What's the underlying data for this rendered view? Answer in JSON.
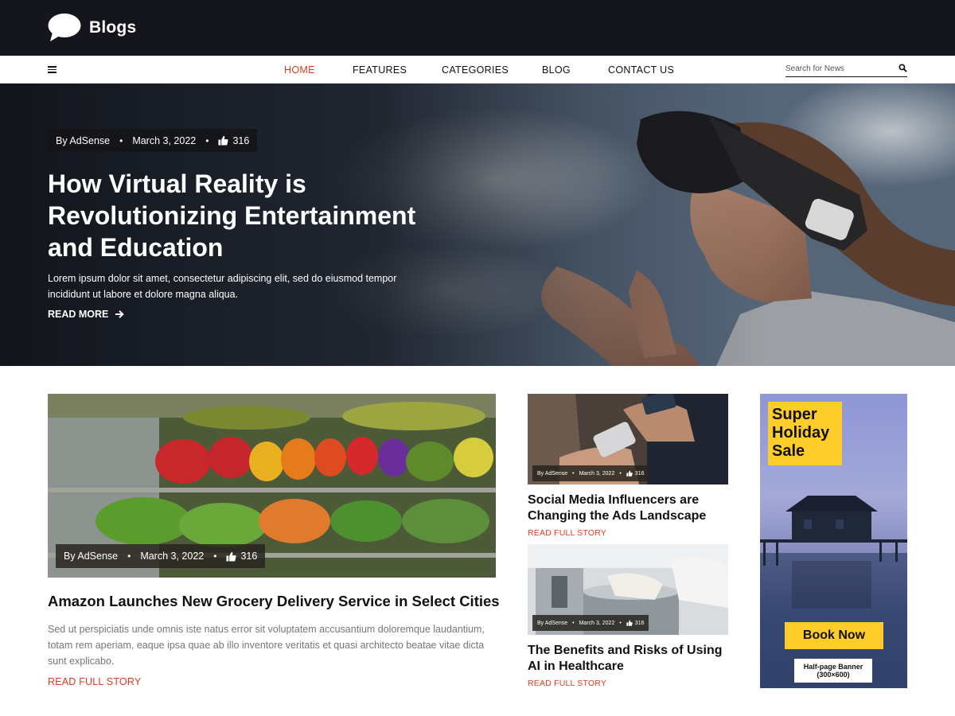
{
  "brand": {
    "name": "Blogs",
    "logo_icon": "speech-bubble-icon"
  },
  "nav": {
    "items": [
      {
        "label": "HOME",
        "active": true
      },
      {
        "label": "FEATURES",
        "active": false
      },
      {
        "label": "CATEGORIES",
        "active": false
      },
      {
        "label": "BLOG",
        "active": false
      },
      {
        "label": "CONTACT US",
        "active": false
      }
    ],
    "search_placeholder": "Search for News",
    "search_value": ""
  },
  "hero": {
    "author": "By AdSense",
    "date": "March 3, 2022",
    "likes": "316",
    "title": "How Virtual Reality is Revolutionizing Entertainment and Education",
    "excerpt": "Lorem ipsum dolor sit amet, consectetur adipiscing elit, sed do eiusmod tempor incididunt ut labore et dolore magna aliqua.",
    "read_more": "READ MORE"
  },
  "featured": {
    "author": "By AdSense",
    "date": "March 3, 2022",
    "likes": "316",
    "title": "Amazon Launches New Grocery Delivery Service in Select Cities",
    "excerpt": "Sed ut perspiciatis unde omnis iste natus error sit voluptatem accusantium doloremque laudantium, totam rem aperiam, eaque ipsa quae ab illo inventore veritatis et quasi architecto beatae vitae dicta sunt explicabo.",
    "read_link": "READ FULL STORY"
  },
  "side_posts": [
    {
      "author": "By AdSense",
      "date": "March 3, 2022",
      "likes": "316",
      "title": "Social Media Influencers are Changing the Ads Landscape",
      "read_link": "READ FULL STORY"
    },
    {
      "author": "By AdSense",
      "date": "March 3, 2022",
      "likes": "316",
      "title": "The Benefits and Risks of Using AI in Healthcare",
      "read_link": "READ FULL STORY"
    }
  ],
  "ad": {
    "headline": "Super Holiday Sale",
    "cta": "Book Now",
    "label_line1": "Half-page Banner",
    "label_line2": "(300×600)"
  },
  "colors": {
    "accent": "#e03a1f",
    "header_bg": "#15161d",
    "ad_yellow": "#ffcd2a"
  }
}
